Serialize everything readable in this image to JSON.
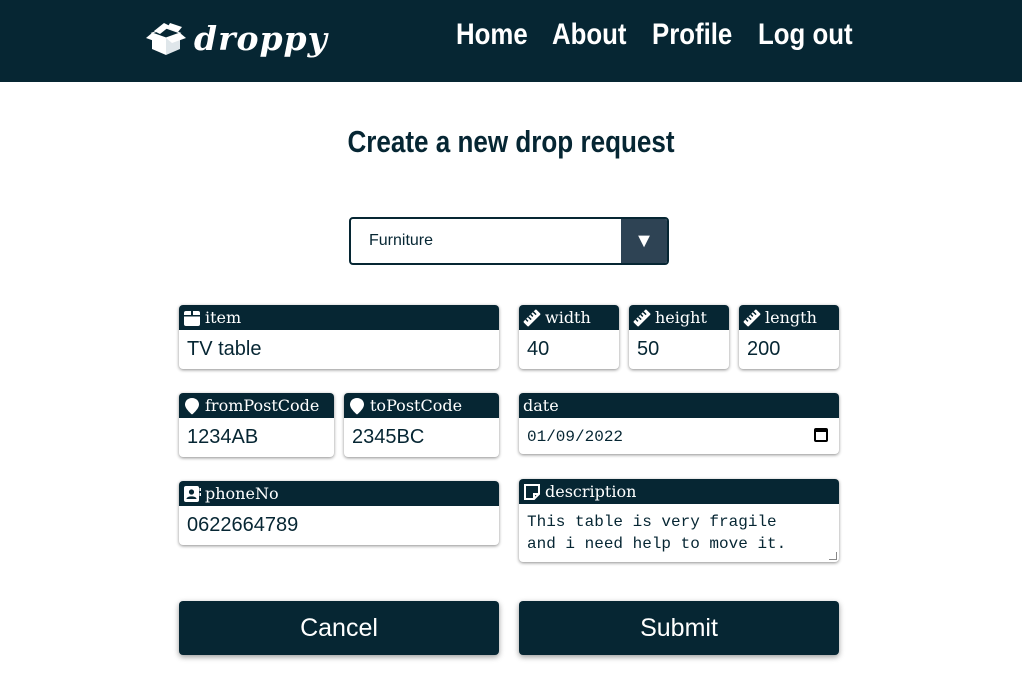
{
  "header": {
    "logo_text": "droppy",
    "nav": [
      "Home",
      "About",
      "Profile",
      "Log out"
    ]
  },
  "page": {
    "title": "Create a new drop request"
  },
  "category_select": {
    "value": "Furniture",
    "arrow": "▼"
  },
  "fields": {
    "item": {
      "label": "item",
      "value": "TV table",
      "icon": "box-icon"
    },
    "width": {
      "label": "width",
      "value": "40",
      "icon": "ruler-icon"
    },
    "height": {
      "label": "height",
      "value": "50",
      "icon": "ruler-icon"
    },
    "length": {
      "label": "length",
      "value": "200",
      "icon": "ruler-icon"
    },
    "from_post_code": {
      "label": "fromPostCode",
      "value": "1234AB",
      "icon": "map-pin-icon"
    },
    "to_post_code": {
      "label": "toPostCode",
      "value": "2345BC",
      "icon": "map-pin-icon"
    },
    "date": {
      "label": "date",
      "value": "01/09/2022",
      "icon": "calendar-icon"
    },
    "phone": {
      "label": "phoneNo",
      "value": "0622664789",
      "icon": "contact-icon"
    },
    "description": {
      "label": "description",
      "value": "This table is very fragile\nand i need help to move it.",
      "icon": "note-icon"
    }
  },
  "buttons": {
    "cancel": "Cancel",
    "submit": "Submit"
  },
  "colors": {
    "primary": "#062633",
    "select_arrow_bg": "#2e4354",
    "background": "#ffffff"
  }
}
